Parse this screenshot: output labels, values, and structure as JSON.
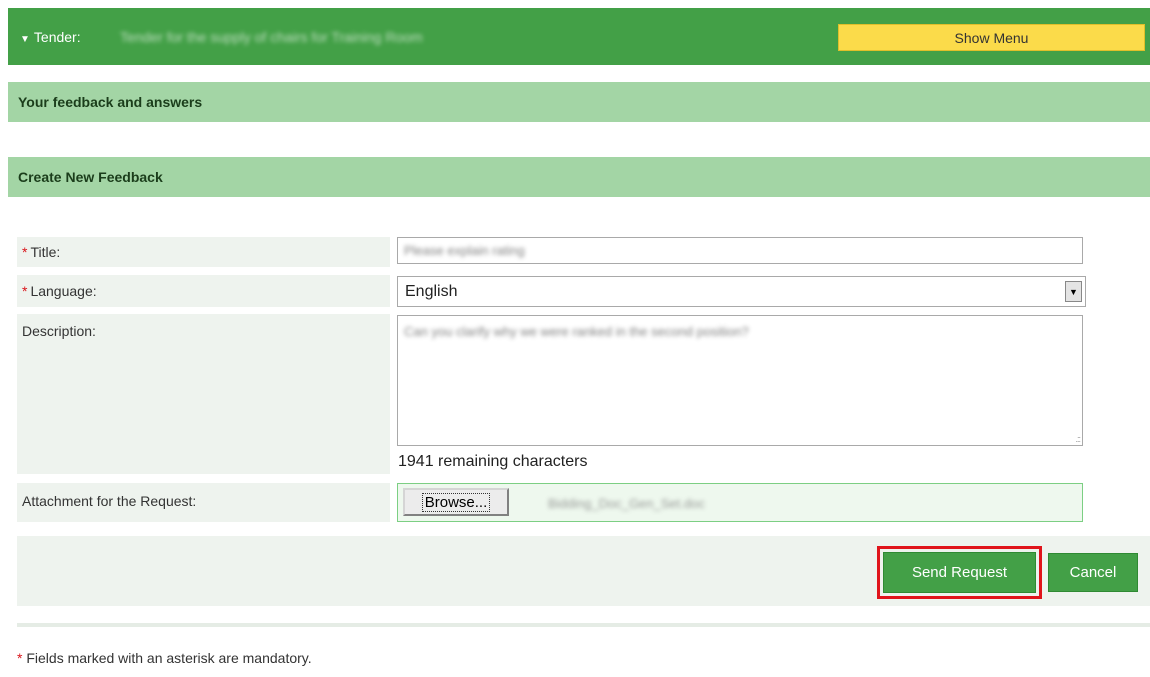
{
  "header": {
    "tender_label": "Tender:",
    "tender_name": "Tender for the supply of chairs for Training Room",
    "show_menu_label": "Show Menu"
  },
  "sections": {
    "feedback_answers": "Your feedback and answers",
    "create_new": "Create New Feedback"
  },
  "form": {
    "required_marker": "*",
    "title_label": "Title:",
    "title_value": "Please explain rating",
    "language_label": "Language:",
    "language_value": "English",
    "description_label": "Description:",
    "description_value": "Can you clarify why we were ranked in the second position?",
    "remaining_text": "1941 remaining characters",
    "attachment_label": "Attachment for the Request:",
    "browse_label": "Browse...",
    "attachment_file": "Bidding_Doc_Gen_Set.doc"
  },
  "actions": {
    "send_label": "Send Request",
    "cancel_label": "Cancel"
  },
  "footer": {
    "required_marker": "*",
    "note": "Fields marked with an asterisk are mandatory."
  },
  "colors": {
    "brand_green": "#43a047",
    "section_green": "#a3d5a5",
    "menu_yellow": "#fbdb4a",
    "required_red": "#d9141a",
    "highlight_red": "#e0141b"
  }
}
